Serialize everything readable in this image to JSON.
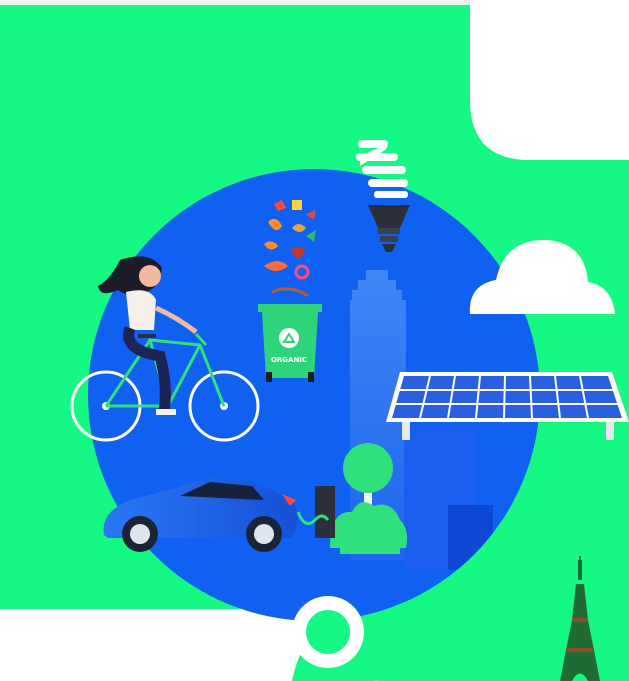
{
  "scene": {
    "bin_label": "ORGANIC",
    "colors": {
      "background_green": "#15f984",
      "globe_blue": "#1060f2",
      "building_blue": "#4a8df5",
      "car_blue": "#1d66e8",
      "solar_panel_blue": "#2a5fe0",
      "bin_green": "#2ed47a",
      "tree_green": "#2fe07c",
      "bulb_dark": "#2a2f3a"
    },
    "icons": [
      "recycle-icon",
      "eiffel-tower-icon",
      "cloud-icon",
      "lightbulb-icon",
      "bicycle-icon",
      "electric-car-icon",
      "solar-panel-icon"
    ]
  }
}
